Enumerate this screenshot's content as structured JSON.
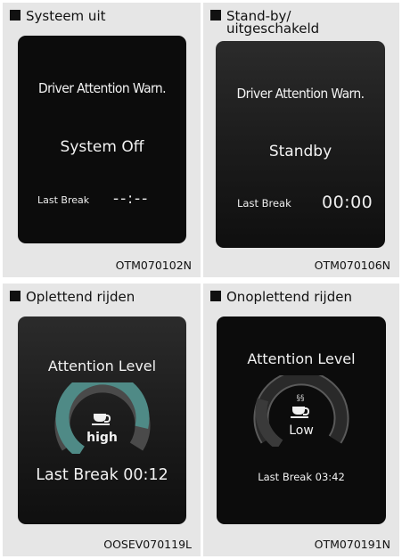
{
  "panels": {
    "p1": {
      "title": "Systeem uit",
      "screen": {
        "line1": "Driver Attention Warn.",
        "line2": "System Off",
        "last_break_label": "Last Break",
        "last_break_value": "--:--"
      },
      "code": "OTM070102N"
    },
    "p2": {
      "title_line1": "Stand-by/",
      "title_line2": "uitgeschakeld",
      "screen": {
        "line1": "Driver Attention Warn.",
        "line2": "Standby",
        "last_break_label": "Last Break",
        "last_break_value": "00:00"
      },
      "code": "OTM070106N"
    },
    "p3": {
      "title": "Oplettend rijden",
      "screen": {
        "heading": "Attention Level",
        "level": "high",
        "last_break": "Last Break 00:12"
      },
      "level_fraction": 0.85,
      "code": "OOSEV070119L"
    },
    "p4": {
      "title": "Onoplettend rijden",
      "screen": {
        "heading": "Attention Level",
        "level": "Low",
        "last_break": "Last Break 03:42"
      },
      "level_fraction": 0.25,
      "code": "OTM070191N"
    }
  },
  "colors": {
    "panel_bg": "#e6e6e6",
    "screen_bg": "#0c0c0c",
    "text": "#f2f2f2",
    "gauge_high": "#4f8a86",
    "gauge_low": "#3a3a3a"
  },
  "icons": {
    "level_icon": "coffee-cup-icon",
    "steam_icon": "steam-icon"
  }
}
